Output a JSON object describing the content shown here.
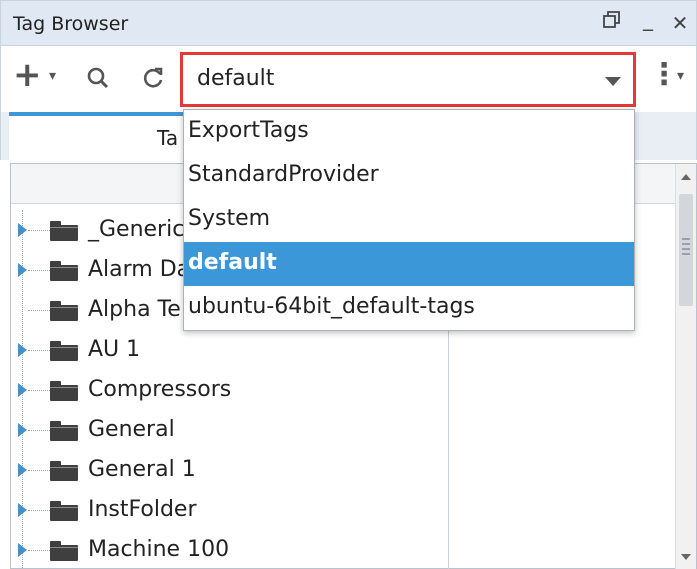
{
  "window": {
    "title": "Tag Browser",
    "restore_icon": "restore-window-icon",
    "minimize_label": "_",
    "close_label": "✕"
  },
  "toolbar": {
    "add_icon": "+",
    "add_caret": "▾",
    "search_icon": "search-icon",
    "refresh_icon": "refresh-icon",
    "more_icon": "⋮",
    "more_caret": "▾"
  },
  "provider": {
    "selected": "default",
    "options": [
      "ExportTags",
      "StandardProvider",
      "System",
      "default",
      "ubuntu-64bit_default-tags"
    ],
    "selected_index": 3
  },
  "tabs": {
    "active_label_partial": "Ta"
  },
  "tree": {
    "rows": [
      {
        "label": "_Generic",
        "expandable": true
      },
      {
        "label": "Alarm Da",
        "expandable": true
      },
      {
        "label": "Alpha Te",
        "expandable": false
      },
      {
        "label": "AU 1",
        "expandable": true
      },
      {
        "label": "Compressors",
        "expandable": true
      },
      {
        "label": "General",
        "expandable": true
      },
      {
        "label": "General 1",
        "expandable": true
      },
      {
        "label": "InstFolder",
        "expandable": true
      },
      {
        "label": "Machine 100",
        "expandable": true
      }
    ]
  },
  "colors": {
    "accent": "#3b97d8",
    "highlight_border": "#e53935",
    "titlebar_bg": "#dfe8f3",
    "folder": "#3f3f3f"
  }
}
